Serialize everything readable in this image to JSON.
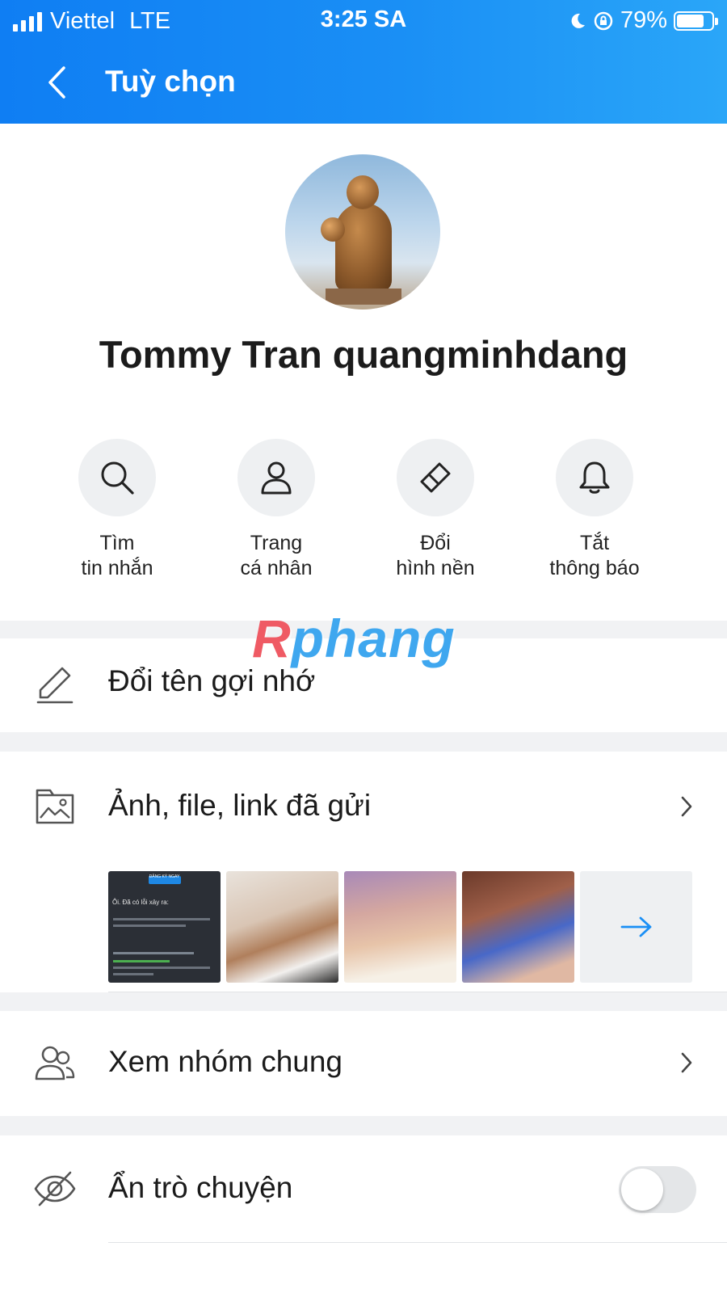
{
  "status_bar": {
    "carrier": "Viettel",
    "network": "LTE",
    "time": "3:25 SA",
    "battery": "79%",
    "battery_level": 0.79
  },
  "header": {
    "title": "Tuỳ chọn",
    "back_icon": "chevron-left-icon"
  },
  "profile": {
    "name": "Tommy Tran quangminhdang"
  },
  "quick_actions": [
    {
      "label": "Tìm\ntin nhắn",
      "icon": "search-icon"
    },
    {
      "label": "Trang\ncá nhân",
      "icon": "person-icon"
    },
    {
      "label": "Đổi\nhình nền",
      "icon": "paint-brush-icon"
    },
    {
      "label": "Tắt\nthông báo",
      "icon": "bell-icon"
    }
  ],
  "watermark": {
    "red_part": "R",
    "blue_part": "phang"
  },
  "rows": {
    "rename": {
      "label": "Đổi tên gợi nhớ",
      "icon": "pencil-icon"
    },
    "media": {
      "label": "Ảnh, file, link đã gửi",
      "icon": "gallery-folder-icon"
    },
    "thumbnail_labels": {
      "error_banner": "ĐĂNG KÝ NGAY",
      "error_title": "Ôi. Đã có lỗi xảy ra:"
    },
    "groups": {
      "label": "Xem nhóm chung",
      "icon": "group-icon"
    },
    "hide_chat": {
      "label": "Ẩn trò chuyện",
      "icon": "eye-off-icon",
      "toggle_on": false
    }
  },
  "colors": {
    "header_start": "#0f7ef3",
    "header_end": "#2aa6f8",
    "accent": "#1a8ff5"
  }
}
